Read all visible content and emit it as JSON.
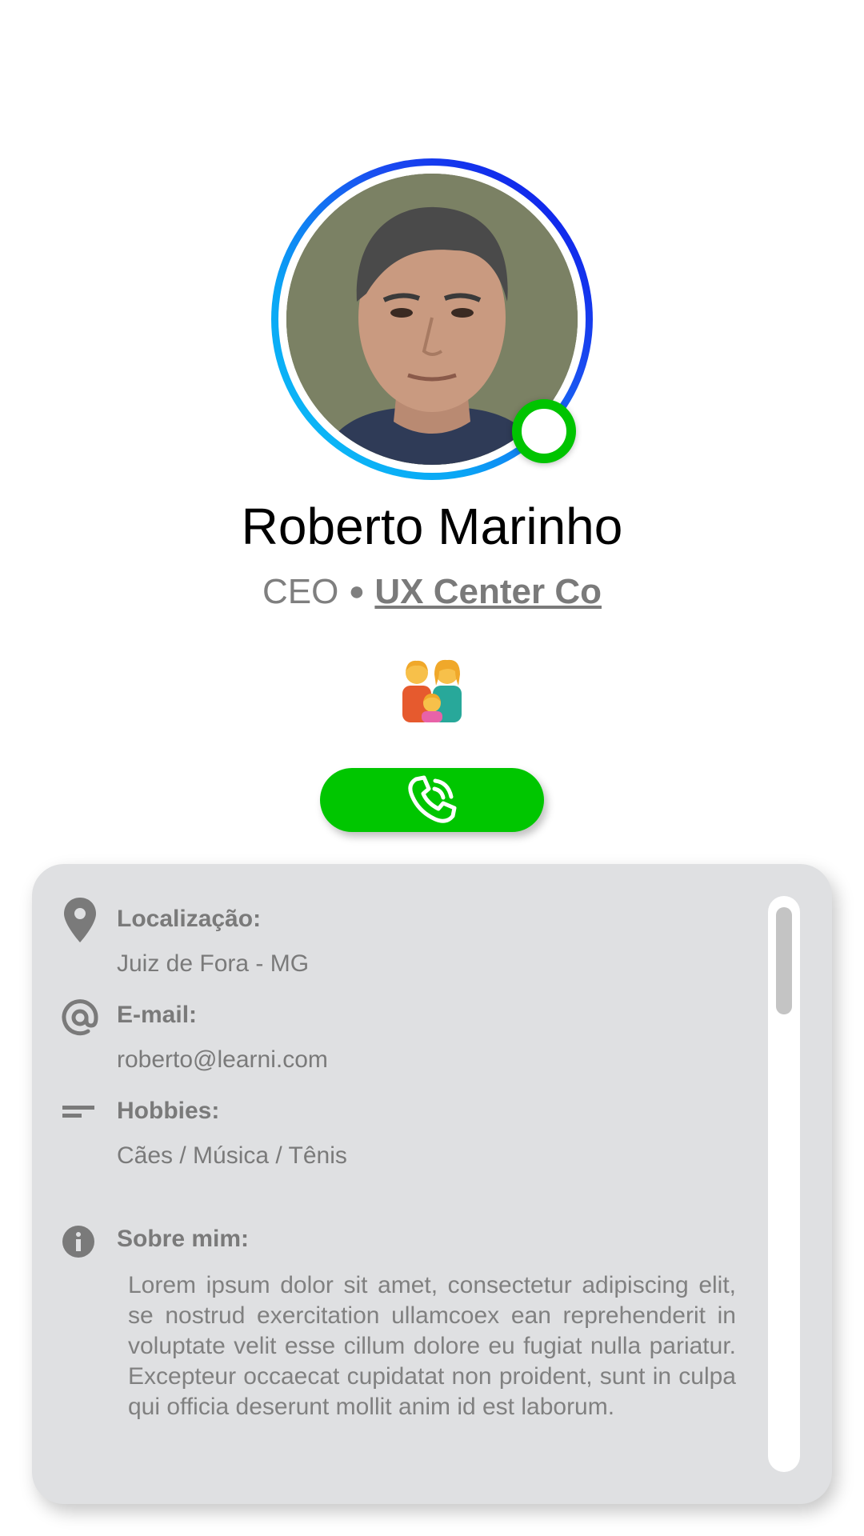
{
  "profile": {
    "name": "Roberto Marinho",
    "role": "CEO",
    "separator": "●",
    "company": "UX Center Co",
    "status": "online",
    "family_emoji": "family-icon"
  },
  "actions": {
    "call_icon": "phone-icon"
  },
  "details": {
    "location_label": "Localização:",
    "location_value": "Juiz de Fora - MG",
    "email_label": "E-mail:",
    "email_value": "roberto@learni.com",
    "hobbies_label": "Hobbies:",
    "hobbies_value": "Cães / Música / Tênis",
    "about_label": "Sobre mim:",
    "about_text": "Lorem ipsum dolor sit amet, consectetur adipiscing elit, se nostrud exercitation ullamcoex ean reprehenderit in voluptate velit esse cillum dolore eu fugiat nulla pariatur. Excepteur occaecat cupidatat non proident, sunt in culpa qui officia deserunt mollit anim id est laborum."
  },
  "colors": {
    "ring_start": "#0a10e8",
    "ring_end": "#0cc2f7",
    "status_online": "#00c400",
    "call_button": "#00c600",
    "card_background": "#dfe0e2",
    "muted_text": "#7a7a7a"
  }
}
